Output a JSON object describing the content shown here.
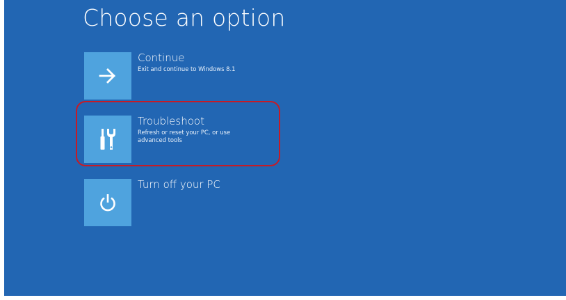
{
  "screen": {
    "title": "Choose an option",
    "background_color": "#2266b3",
    "tile_color": "#4fa3de",
    "highlight_color": "#c61b26"
  },
  "options": [
    {
      "title": "Continue",
      "description": "Exit and continue to Windows 8.1",
      "icon": "arrow-right-icon"
    },
    {
      "title": "Troubleshoot",
      "description": "Refresh or reset your PC, or use advanced tools",
      "icon": "tools-icon",
      "highlighted": true
    },
    {
      "title": "Turn off your PC",
      "description": "",
      "icon": "power-icon"
    }
  ]
}
